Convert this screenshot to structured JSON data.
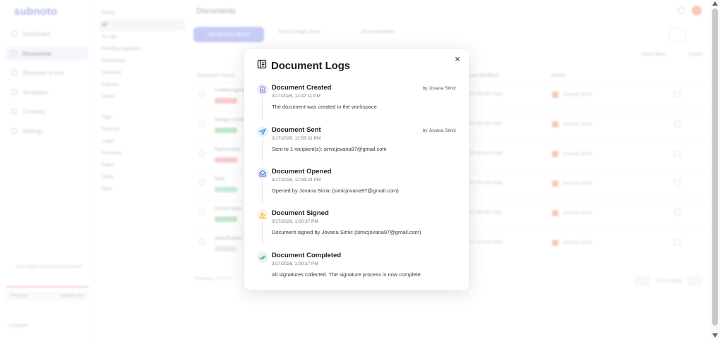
{
  "app": {
    "logo": "subnoto",
    "nav": [
      {
        "label": "Dashboard"
      },
      {
        "label": "Documents"
      },
      {
        "label": "Requests to you"
      },
      {
        "label": "Templates"
      },
      {
        "label": "Contacts"
      },
      {
        "label": "Settings"
      }
    ],
    "promo": "Start a plan to unlock more features",
    "plan": {
      "left": "Free plan",
      "right": "Upgrade now"
    },
    "collapse": "Collapse"
  },
  "subnav": {
    "items": [
      "Home",
      "All",
      "To sign",
      "Pending signature",
      "Completed",
      "Declined",
      "Expired",
      "Drafts"
    ],
    "tags_header": "Tags",
    "tags": [
      "Finance",
      "Legal",
      "Personal",
      "Sales",
      "Other",
      "New"
    ]
  },
  "main": {
    "title": "Documents",
    "primary_button": "Upload from device",
    "google_drive": "From Google Drive",
    "documentation": "Documentation",
    "filters": "Show filters",
    "export": "Export",
    "columns": {
      "name": "Document Name",
      "modified": "Last Modified",
      "owner": "Owner"
    },
    "rows": [
      {
        "name": "Untitled agreement",
        "modified": "20 minutes ago",
        "owner": "Jovana Simić",
        "tag_color": "#f4a2a2"
      },
      {
        "name": "Design Contract",
        "modified": "20 minutes ago",
        "owner": "Jovana Simić",
        "tag_color": "#8fd3a2"
      },
      {
        "name": "Partnership",
        "modified": "20 minutes ago",
        "owner": "Jovana Simić",
        "tag_color": "#f4a2a2"
      },
      {
        "name": "NDA",
        "modified": "20 minutes ago",
        "owner": "Jovana Simić",
        "tag_color": "#9fd8c6"
      },
      {
        "name": "Service plan",
        "modified": "21 minutes ago",
        "owner": "Jovana Simić",
        "tag_color": "#8fd3a2"
      },
      {
        "name": "Specification",
        "modified": "21 minutes ago",
        "owner": "Jovana Simić",
        "tag_color": "#dcdce2"
      }
    ],
    "showing": "Showing 1 to 6 of 6",
    "per_page": "10 per page"
  },
  "modal": {
    "title": "Document Logs",
    "icon": "document-log-icon",
    "close_label": "×",
    "logs": [
      {
        "title": "Document Created",
        "by": "by Jovana Simić",
        "time": "3/17/2026, 12:47:11 PM",
        "description": "The document was created in the workspace.",
        "icon": "file-plus-icon",
        "color": "#7c6fd8",
        "bg": "#eeebfb"
      },
      {
        "title": "Document Sent",
        "by": "by Jovana Simić",
        "time": "3/17/2026, 12:58:31 PM",
        "description": "Sent to 1 recipient(s): simicjovana97@gmail.com",
        "icon": "send-icon",
        "color": "#3a8fe0",
        "bg": "#e8f2fc"
      },
      {
        "title": "Document Opened",
        "by": "",
        "time": "3/17/2026, 12:59:24 PM",
        "description": "Opened by Jovana Simic (simicjovana97@gmail.com)",
        "icon": "mail-open-icon",
        "color": "#3a6fd0",
        "bg": "#e8eefb"
      },
      {
        "title": "Document Signed",
        "by": "",
        "time": "3/17/2026, 1:00:37 PM",
        "description": "Document signed by Jovana Simic (simicjovana97@gmail.com)",
        "icon": "signature-icon",
        "color": "#e0a020",
        "bg": "#fdf4e0"
      },
      {
        "title": "Document Completed",
        "by": "",
        "time": "3/17/2026, 1:00:37 PM",
        "description": "All signatures collected. The signature process is now complete.",
        "icon": "check-double-icon",
        "color": "#2f9e5a",
        "bg": "#e6f6ec"
      }
    ]
  }
}
